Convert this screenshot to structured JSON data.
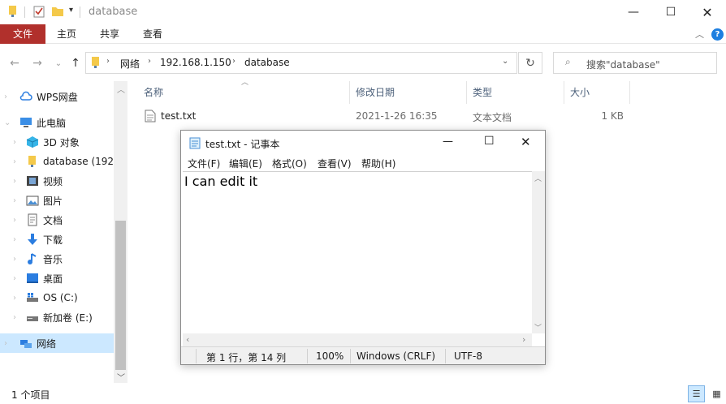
{
  "window": {
    "title": "database"
  },
  "ribbon": {
    "tabs": [
      "文件",
      "主页",
      "共享",
      "查看"
    ]
  },
  "nav": {
    "path": [
      "网络",
      "192.168.1.150",
      "database"
    ],
    "search_placeholder": "搜索\"database\""
  },
  "sidebar": {
    "items": [
      {
        "label": "WPS网盘",
        "icon": "cloud-icon",
        "level": 0
      },
      {
        "label": "此电脑",
        "icon": "computer-icon",
        "level": 0
      },
      {
        "label": "3D 对象",
        "icon": "cube-icon",
        "level": 1
      },
      {
        "label": "database (192.",
        "icon": "network-folder-icon",
        "level": 1
      },
      {
        "label": "视频",
        "icon": "video-icon",
        "level": 1
      },
      {
        "label": "图片",
        "icon": "picture-icon",
        "level": 1
      },
      {
        "label": "文档",
        "icon": "document-icon",
        "level": 1
      },
      {
        "label": "下载",
        "icon": "download-icon",
        "level": 1
      },
      {
        "label": "音乐",
        "icon": "music-icon",
        "level": 1
      },
      {
        "label": "桌面",
        "icon": "desktop-icon",
        "level": 1
      },
      {
        "label": "OS (C:)",
        "icon": "drive-icon",
        "level": 1
      },
      {
        "label": "新加卷 (E:)",
        "icon": "drive-icon",
        "level": 1
      },
      {
        "label": "网络",
        "icon": "network-icon",
        "level": 0,
        "selected": true
      }
    ]
  },
  "filelist": {
    "columns": [
      "名称",
      "修改日期",
      "类型",
      "大小"
    ],
    "rows": [
      {
        "name": "test.txt",
        "modified": "2021-1-26 16:35",
        "type": "文本文档",
        "size": "1 KB"
      }
    ]
  },
  "status": {
    "count": "1 个项目"
  },
  "notepad": {
    "title": "test.txt - 记事本",
    "menu": [
      "文件(F)",
      "编辑(E)",
      "格式(O)",
      "查看(V)",
      "帮助(H)"
    ],
    "content": "I can edit it",
    "status": {
      "position": "第 1 行，第 14 列",
      "zoom": "100%",
      "line_ending": "Windows (CRLF)",
      "encoding": "UTF-8"
    }
  },
  "colors": {
    "file_tab": "#b1302c",
    "selected_bg": "#cce8ff",
    "header_text": "#4c607a"
  }
}
